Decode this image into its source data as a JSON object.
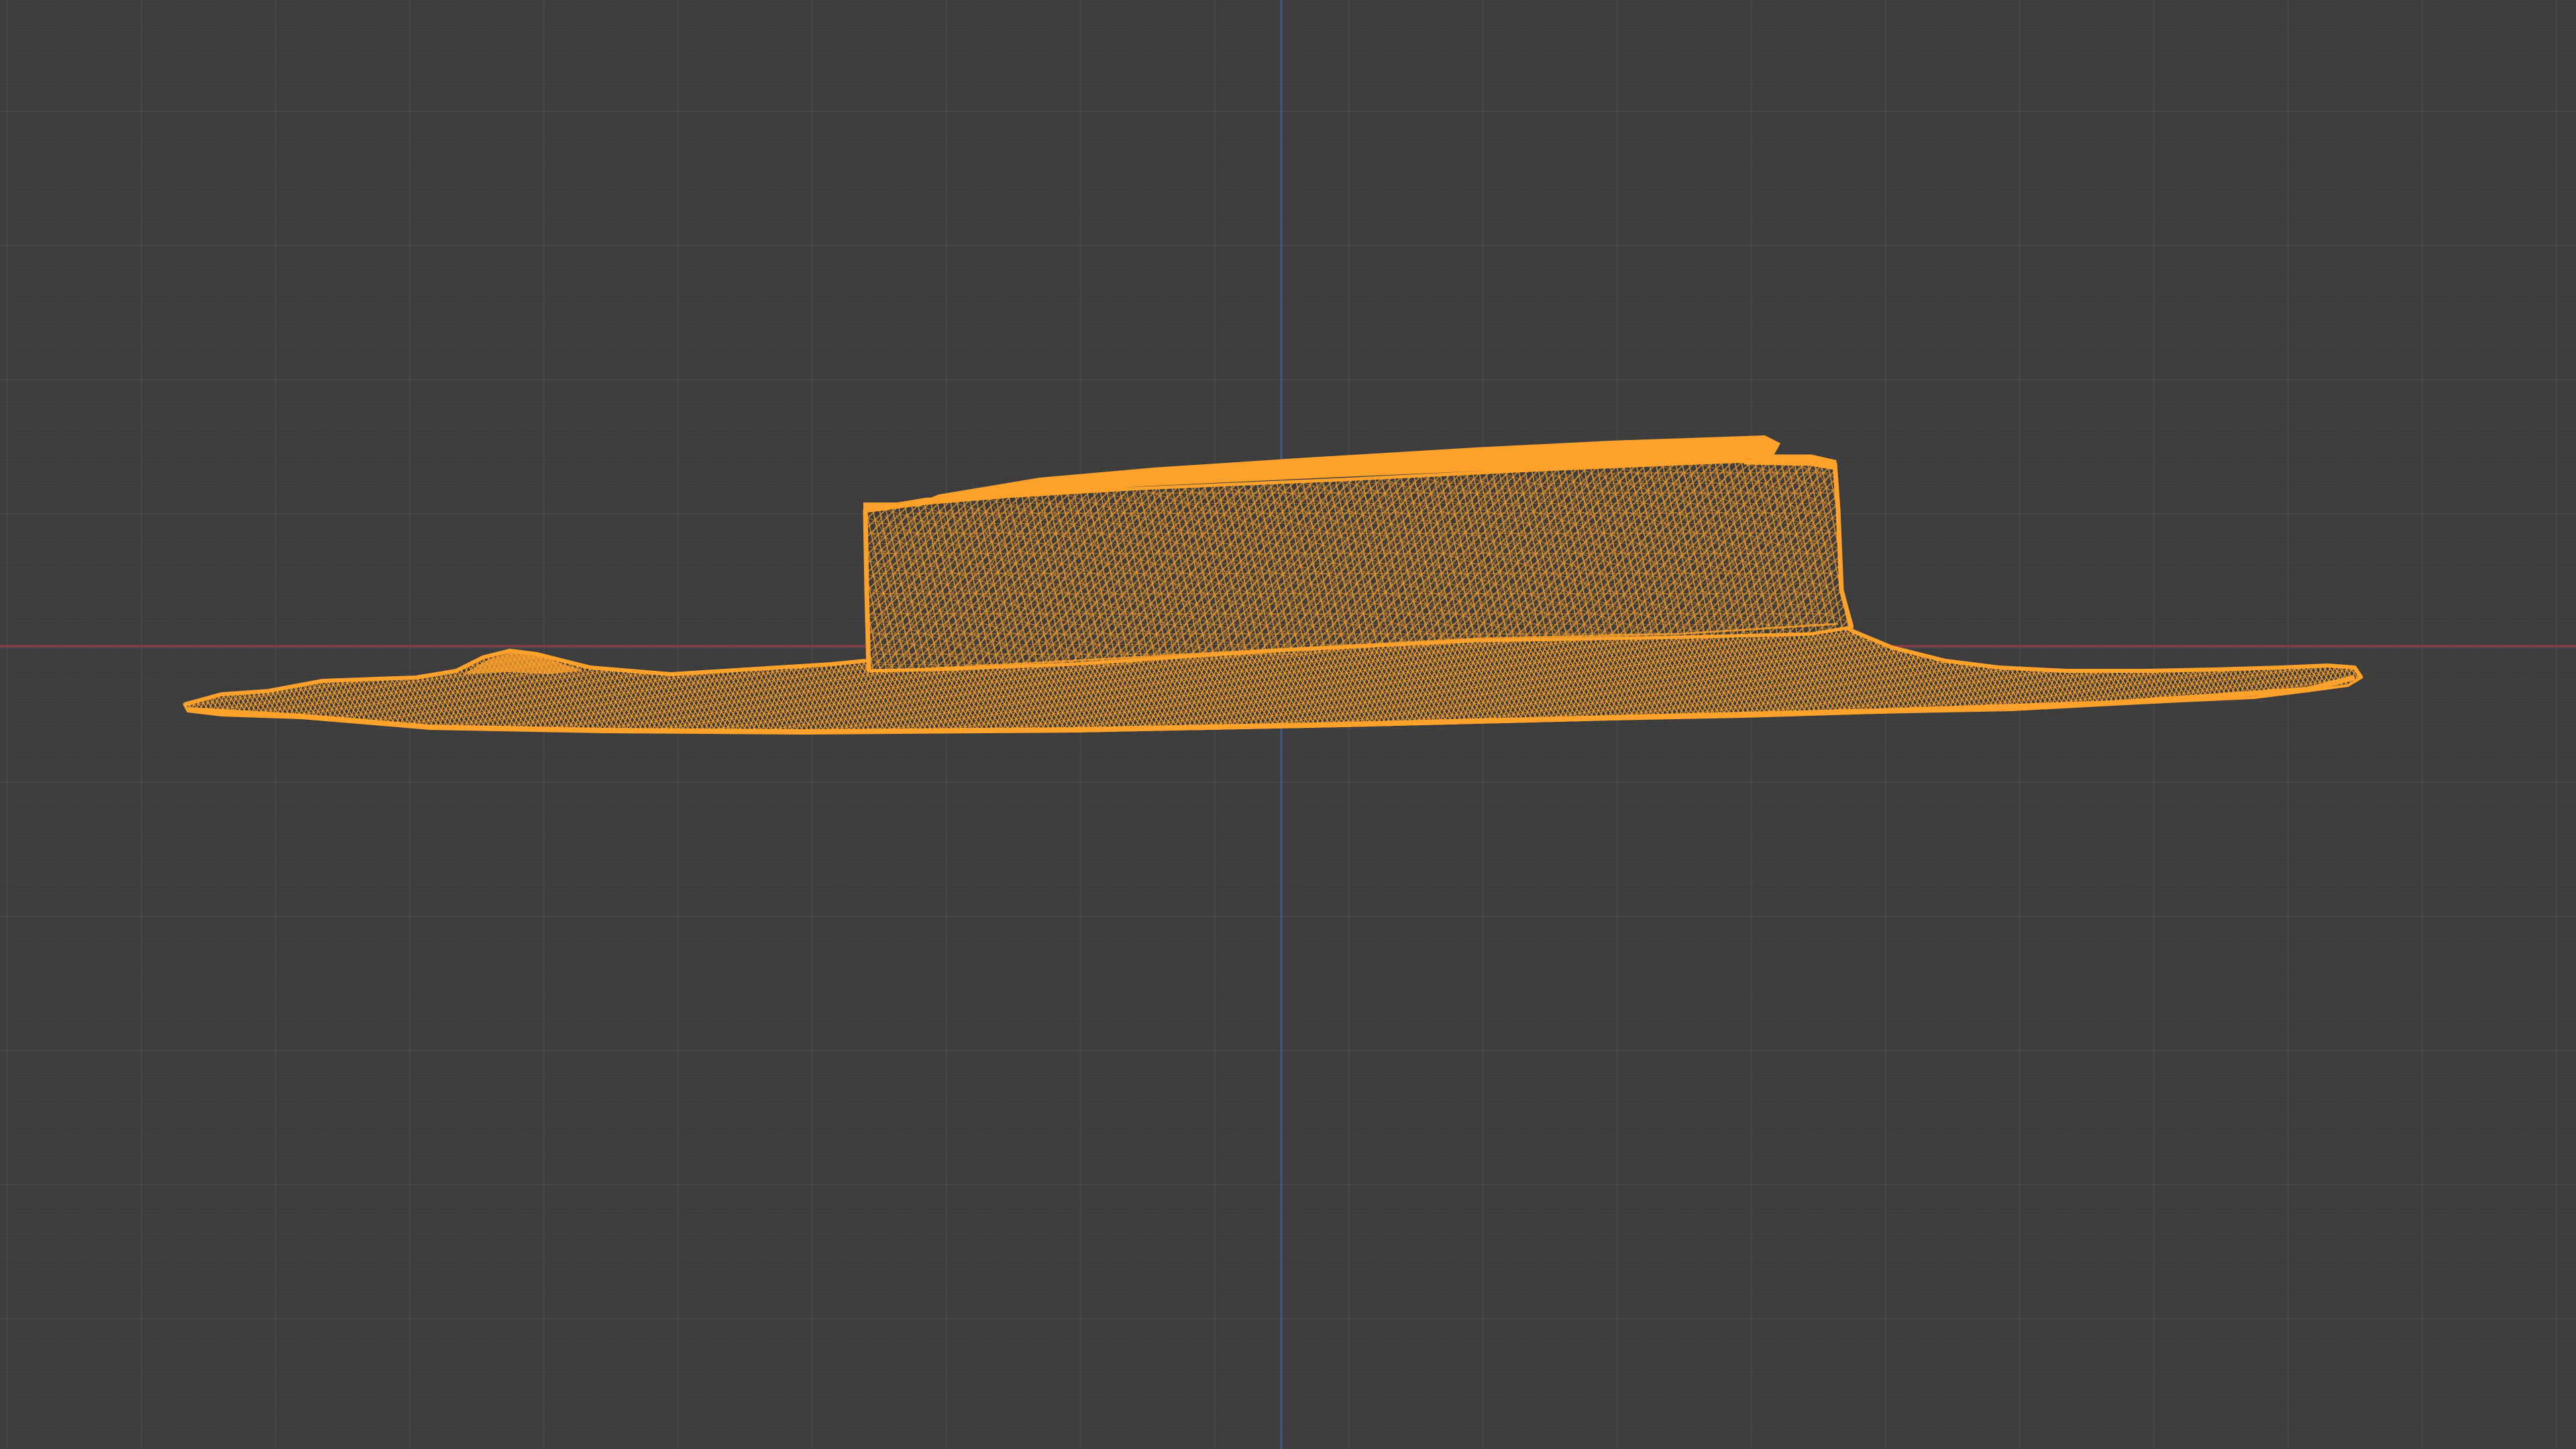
{
  "viewport": {
    "view": "front-orthographic",
    "background_color": "#3d3d3d",
    "grid": {
      "visible": true,
      "minor_color": "#444444",
      "major_color": "#4c4c4c"
    },
    "axes": {
      "x_axis_color": "#8f3a45",
      "z_axis_color": "#3f5a80"
    },
    "object": {
      "type": "mesh",
      "shading": "wireframe",
      "selected": true,
      "wire_color": "#ffa22b",
      "icon": "wireframe-mesh-icon"
    }
  }
}
